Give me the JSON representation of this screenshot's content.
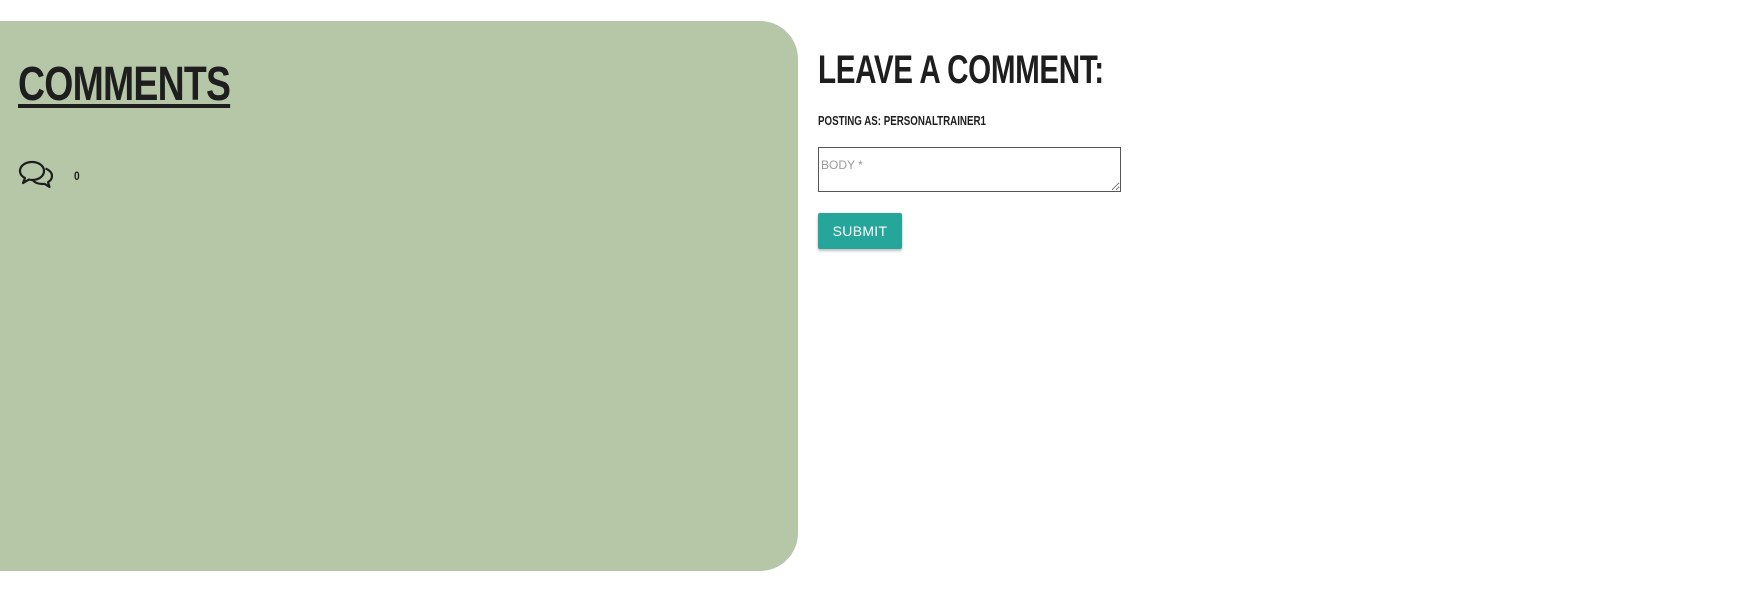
{
  "comments_panel": {
    "heading": "COMMENTS",
    "icon": "comments-icon",
    "count": "0",
    "background_color": "#b5c7a7"
  },
  "comment_form": {
    "heading": "LEAVE A COMMENT:",
    "posting_as": "POSTING AS: PERSONALTRAINER1",
    "body_value": "",
    "body_placeholder": "BODY *",
    "submit_label": "SUBMIT",
    "accent_color": "#26a69a"
  }
}
